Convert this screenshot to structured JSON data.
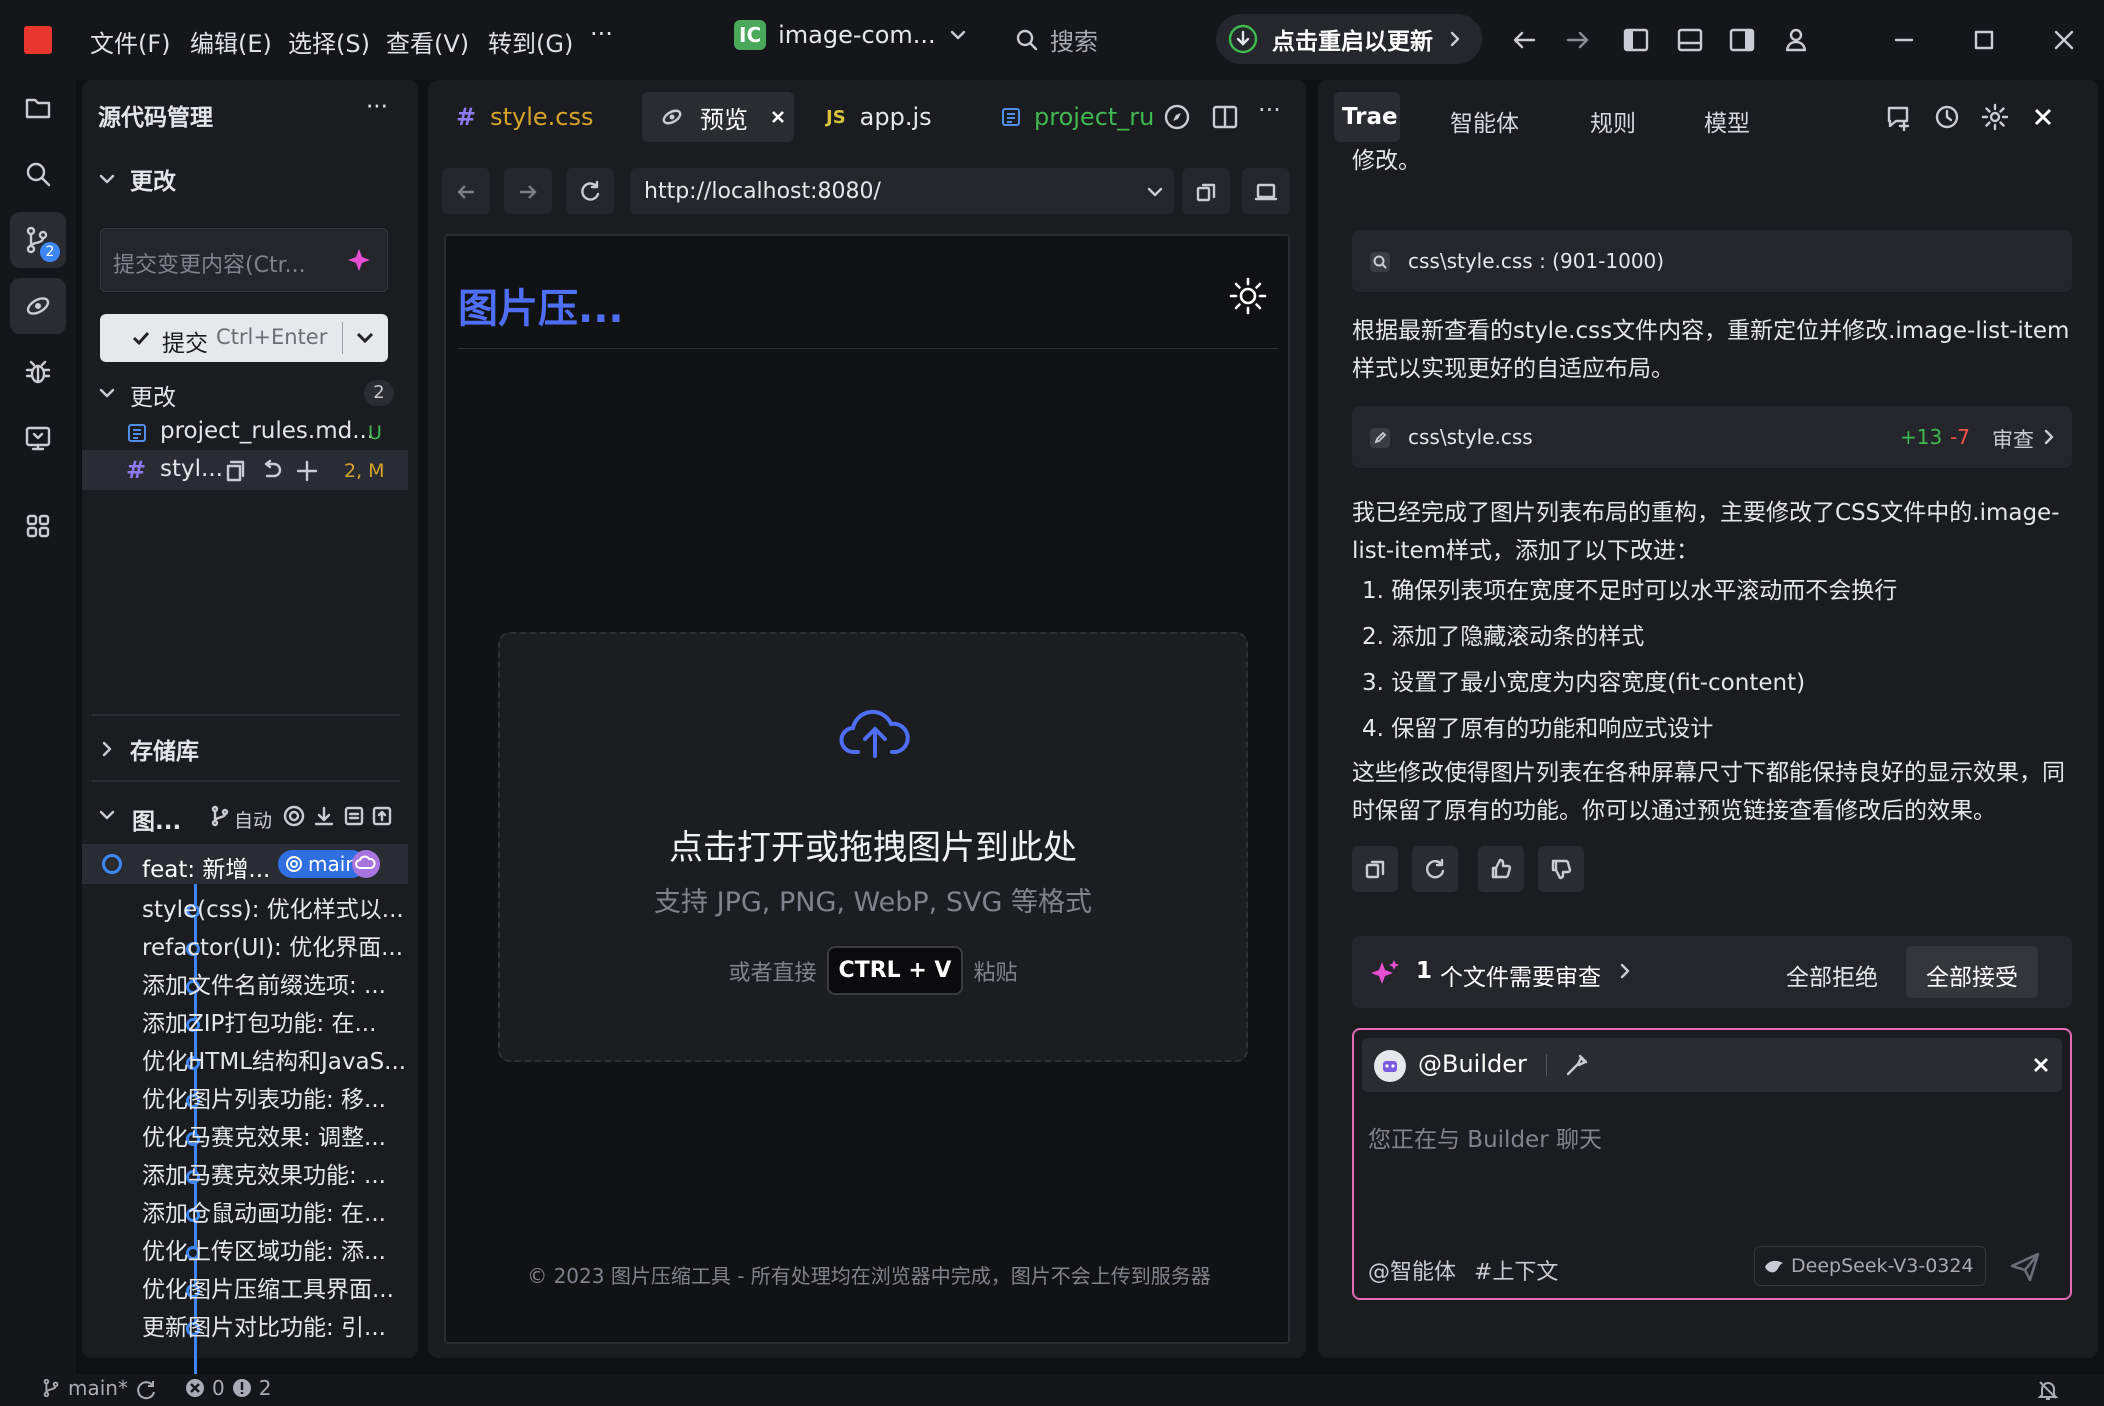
{
  "menu": {
    "file": "文件(F)",
    "edit": "编辑(E)",
    "select": "选择(S)",
    "view": "查看(V)",
    "goto": "转到(G)",
    "more": "···"
  },
  "project": {
    "badge": "IC",
    "name": "image-com..."
  },
  "search": {
    "placeholder": "搜索"
  },
  "update": {
    "label": "点击重启以更新"
  },
  "scm": {
    "title": "源代码管理",
    "more": "···",
    "changes_header": "更改",
    "message_placeholder": "提交变更内容(Ctr...",
    "commit_label": "提交",
    "commit_shortcut": "Ctrl+Enter",
    "changes_group": "更改",
    "changes_count": "2",
    "files": [
      {
        "name": "project_rules.md...",
        "status": "U"
      },
      {
        "name": "styl...",
        "status": "2, M"
      }
    ],
    "repo_header": "存储库",
    "graph_header": "图...",
    "auto_label": "自动",
    "commits": [
      "feat: 新增...",
      "style(css): 优化样式以...",
      "refactor(UI): 优化界面...",
      "添加文件名前缀选项: ...",
      "添加ZIP打包功能: 在...",
      "优化HTML结构和JavaS...",
      "优化图片列表功能: 移...",
      "优化马赛克效果: 调整...",
      "添加马赛克效果功能: ...",
      "添加仓鼠动画功能: 在...",
      "优化上传区域功能: 添...",
      "优化图片压缩工具界面...",
      "更新图片对比功能: 引..."
    ],
    "branch_badge": "main"
  },
  "editor": {
    "tabs": [
      {
        "icon": "#",
        "label": "style.css"
      },
      {
        "icon": "preview",
        "label": "预览"
      },
      {
        "icon": "JS",
        "label": "app.js"
      },
      {
        "icon": "md",
        "label": "project_ru"
      }
    ],
    "more": "···",
    "url": "http://localhost:8080/"
  },
  "preview": {
    "title": "图片压...",
    "upload_main": "点击打开或拖拽图片到此处",
    "upload_formats": "支持 JPG, PNG, WebP, SVG 等格式",
    "paste_prefix": "或者直接",
    "paste_key": "CTRL + V",
    "paste_suffix": "粘贴",
    "footer": "© 2023 图片压缩工具 - 所有处理均在浏览器中完成，图片不会上传到服务器"
  },
  "chat": {
    "tabs": [
      "Trae",
      "智能体",
      "规则",
      "模型"
    ],
    "cut_text": "需要查看style.css文件中.image-list-item样式的具体位置以进行精确修改。",
    "chip1": "css\\style.css : (901-1000)",
    "para1": "根据最新查看的style.css文件内容，重新定位并修改.image-list-item样式以实现更好的自适应布局。",
    "chip2": "css\\style.css",
    "chip2_added": "+13",
    "chip2_removed": "-7",
    "chip2_review": "审查",
    "para2": "我已经完成了图片列表布局的重构，主要修改了CSS文件中的.image-list-item样式，添加了以下改进：",
    "list": [
      "1. 确保列表项在宽度不足时可以水平滚动而不会换行",
      "2. 添加了隐藏滚动条的样式",
      "3. 设置了最小宽度为内容宽度(fit-content)",
      "4. 保留了原有的功能和响应式设计"
    ],
    "para3": "这些修改使得图片列表在各种屏幕尺寸下都能保持良好的显示效果，同时保留了原有的功能。你可以通过预览链接查看修改后的效果。",
    "review_count": "1",
    "review_label": "个文件需要审查",
    "reject_all": "全部拒绝",
    "accept_all": "全部接受",
    "agent": "@Builder",
    "input_placeholder": "您正在与 Builder 聊天",
    "at_agent": "@智能体",
    "context": "#上下文",
    "model": "DeepSeek-V3-0324"
  },
  "status": {
    "branch": "main*",
    "errors": "0",
    "warnings": "2"
  },
  "colors": {
    "accent": "#3f86f5",
    "brand_red": "#e8372c",
    "added": "#3fb950",
    "removed": "#f0544c",
    "modified": "#d7a42a"
  }
}
